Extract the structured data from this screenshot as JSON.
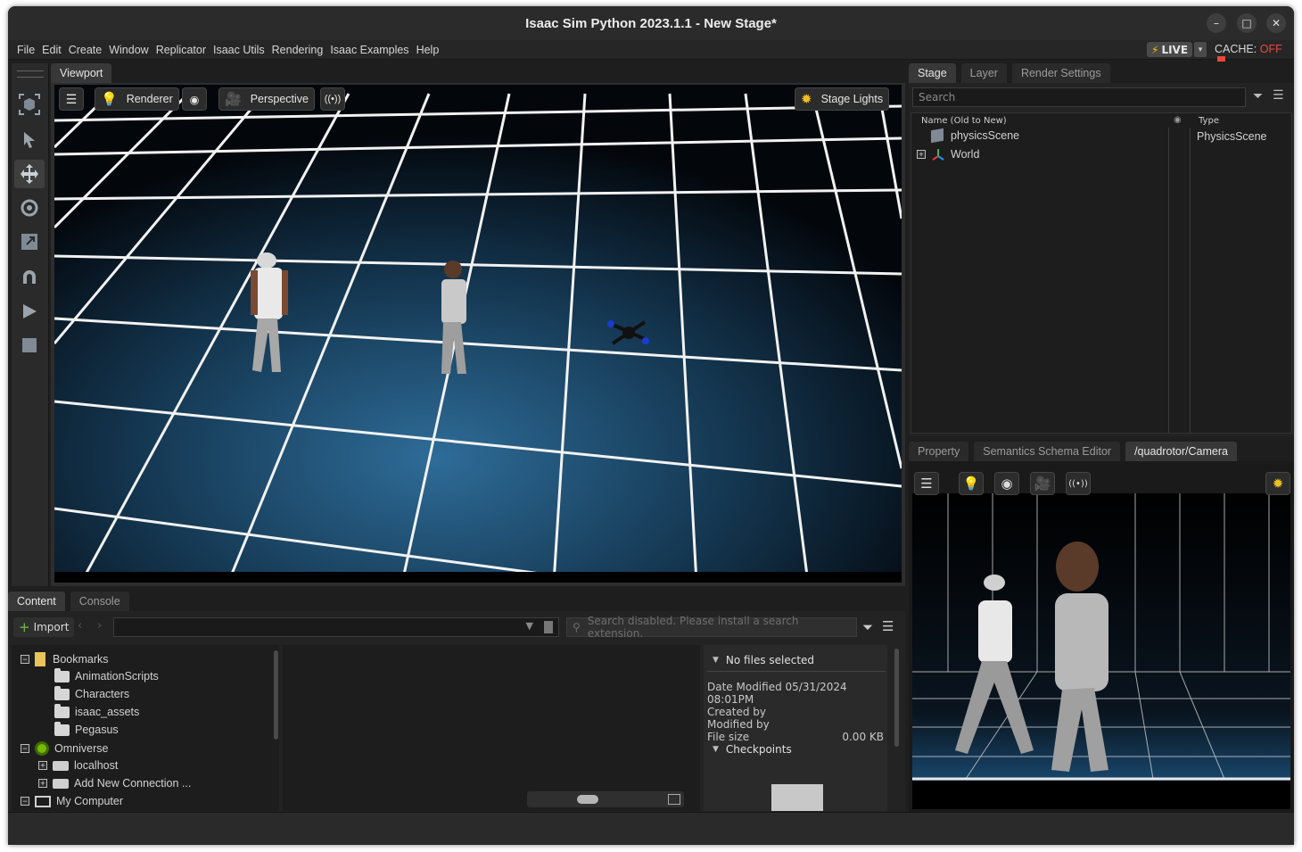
{
  "window": {
    "title": "Isaac Sim Python 2023.1.1 - New Stage*",
    "min_glyph": "–",
    "max_glyph": "□",
    "close_glyph": "✕"
  },
  "menu": [
    "File",
    "Edit",
    "Create",
    "Window",
    "Replicator",
    "Isaac Utils",
    "Rendering",
    "Isaac Examples",
    "Help"
  ],
  "live": {
    "label": "LIVE",
    "bolt": "⚡",
    "dropdown": "▾"
  },
  "cache": {
    "label": "CACHE:",
    "state": "OFF",
    "state_color": "#e64a3d"
  },
  "toolbar": {
    "icons": [
      "frame-icon",
      "select-arrow-icon",
      "move-icon",
      "rotate-icon",
      "scale-icon",
      "snap-magnet-icon",
      "play-icon",
      "stop-icon"
    ]
  },
  "viewport": {
    "tab": "Viewport",
    "buttons": {
      "renderer": "Renderer",
      "perspective": "Perspective",
      "stage_lights": "Stage Lights"
    }
  },
  "stage_panel": {
    "tabs": [
      "Stage",
      "Layer",
      "Render Settings"
    ],
    "search_placeholder": "Search",
    "col_name": "Name (Old to New)",
    "col_type": "Type",
    "rows": [
      {
        "name": "physicsScene",
        "type": "PhysicsScene"
      },
      {
        "name": "World",
        "type": ""
      }
    ]
  },
  "property_panel": {
    "tabs": [
      "Property",
      "Semantics Schema Editor",
      "/quadrotor/Camera"
    ]
  },
  "content_panel": {
    "tabs": [
      "Content",
      "Console"
    ],
    "import": "Import",
    "search_placeholder": "Search disabled. Please install a search extension.",
    "tree": [
      {
        "label": "Bookmarks",
        "level": 0,
        "expander": "−"
      },
      {
        "label": "AnimationScripts",
        "level": 1
      },
      {
        "label": "Characters",
        "level": 1
      },
      {
        "label": "isaac_assets",
        "level": 1
      },
      {
        "label": "Pegasus",
        "level": 1
      },
      {
        "label": "Omniverse",
        "level": 0,
        "expander": "−"
      },
      {
        "label": "localhost",
        "level": 1,
        "expander": "+"
      },
      {
        "label": "Add New Connection ...",
        "level": 1,
        "expander": "+"
      },
      {
        "label": "My Computer",
        "level": 0,
        "expander": "−"
      }
    ],
    "details": {
      "header": "No files selected",
      "date_modified_label": "Date Modified",
      "date_modified": "05/31/2024 08:01PM",
      "created_by": "Created by",
      "modified_by": "Modified by",
      "file_size_label": "File size",
      "file_size": "0.00 KB",
      "checkpoints": "Checkpoints"
    }
  }
}
